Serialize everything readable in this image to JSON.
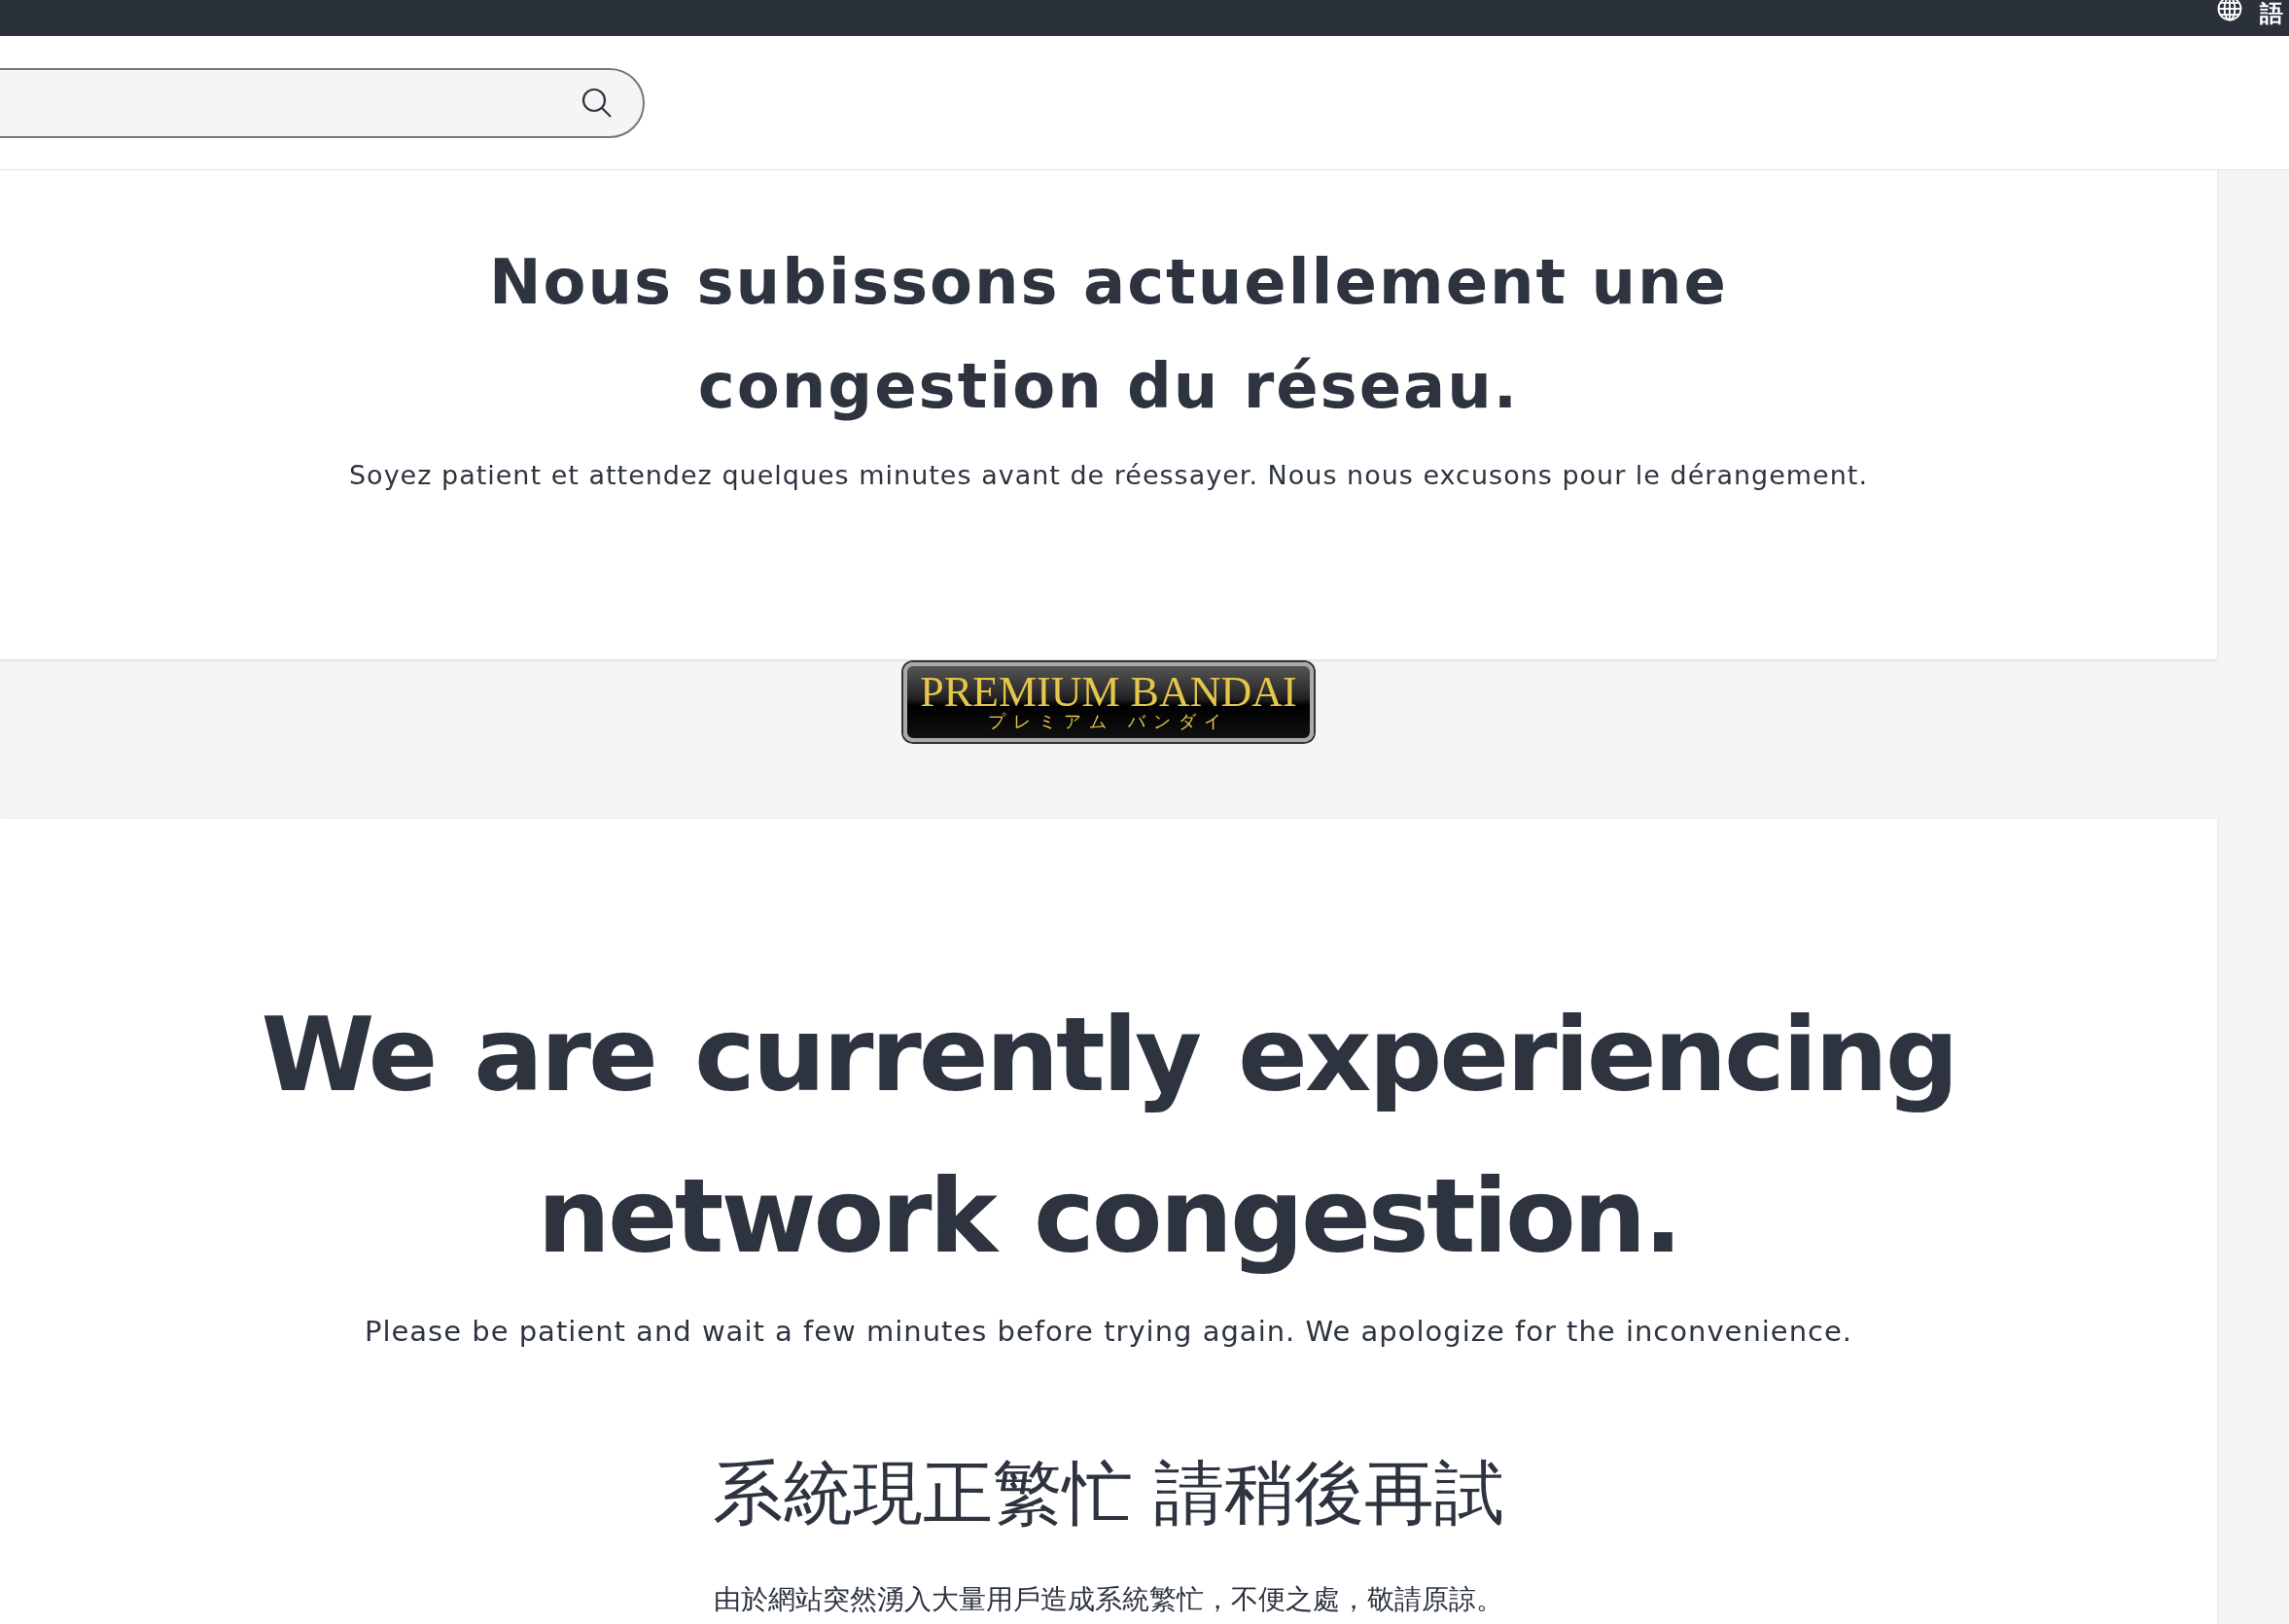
{
  "top_bar": {
    "language_label": "語"
  },
  "notices": [
    {
      "kind": "card",
      "heading": "Nous subissons actuellement une congestion du réseau.",
      "message": "Soyez patient et attendez quelques minutes avant de réessayer. Nous nous excusons pour le dérangement."
    },
    {
      "kind": "logo",
      "title": "PREMIUM BANDAI",
      "subtitle": "プレミアム バンダイ"
    },
    {
      "kind": "card-large",
      "heading": "We are currently experiencing network congestion.",
      "message": "Please be patient and wait a few minutes before trying again. We apologize for the inconvenience.",
      "heading_zh": "系統現正繁忙 請稍後再試",
      "message_zh": "由於網站突然湧入大量用戶造成系統繁忙，不便之處，敬請原諒。"
    }
  ]
}
